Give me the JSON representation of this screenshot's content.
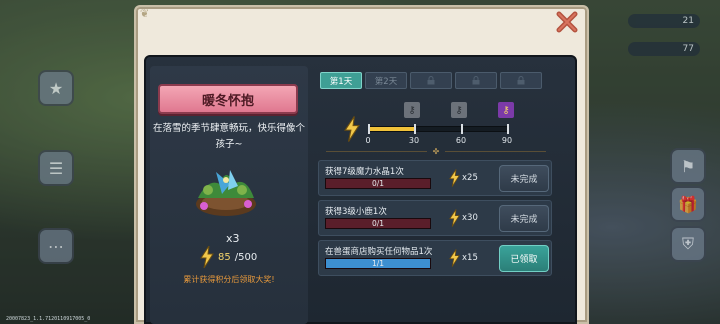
{
  "event": {
    "title": "暖冬怀抱",
    "description": "在落雪的季节肆意畅玩，快乐得像个孩子~",
    "gift_count": "x3",
    "points_current": "85",
    "points_total": "/500",
    "hint": "累计获得积分后领取大奖!"
  },
  "tabs": [
    {
      "label": "第1天",
      "state": "active"
    },
    {
      "label": "第2天",
      "state": "inactive"
    },
    {
      "label": "",
      "state": "locked"
    },
    {
      "label": "",
      "state": "locked"
    },
    {
      "label": "",
      "state": "locked"
    }
  ],
  "progress": {
    "value": 30,
    "max": 90,
    "ticks": [
      "0",
      "30",
      "60",
      "90"
    ],
    "milestone_icons": [
      "gray-key-icon",
      "gray-key-icon",
      "purple-key-icon"
    ]
  },
  "tasks": [
    {
      "title": "获得7级魔力水晶1次",
      "progress": "0/1",
      "fraction": 0,
      "reward": "x25",
      "button": "未完成",
      "state": "incomplete"
    },
    {
      "title": "获得3级小鹿1次",
      "progress": "0/1",
      "fraction": 0,
      "reward": "x30",
      "button": "未完成",
      "state": "incomplete"
    },
    {
      "title": "在兽蛋商店购买任何物品1次",
      "progress": "1/1",
      "fraction": 1,
      "reward": "x15",
      "button": "已领取",
      "state": "claimed"
    }
  ],
  "hud": {
    "value1": "21",
    "value2": "77"
  },
  "build_info": "20007823_1.1.7120110917005_0",
  "colors": {
    "accent_teal": "#3f9f95",
    "bolt_yellow": "#f2c84a",
    "hint_orange": "#e99a3c",
    "close_red": "#b4533f"
  }
}
